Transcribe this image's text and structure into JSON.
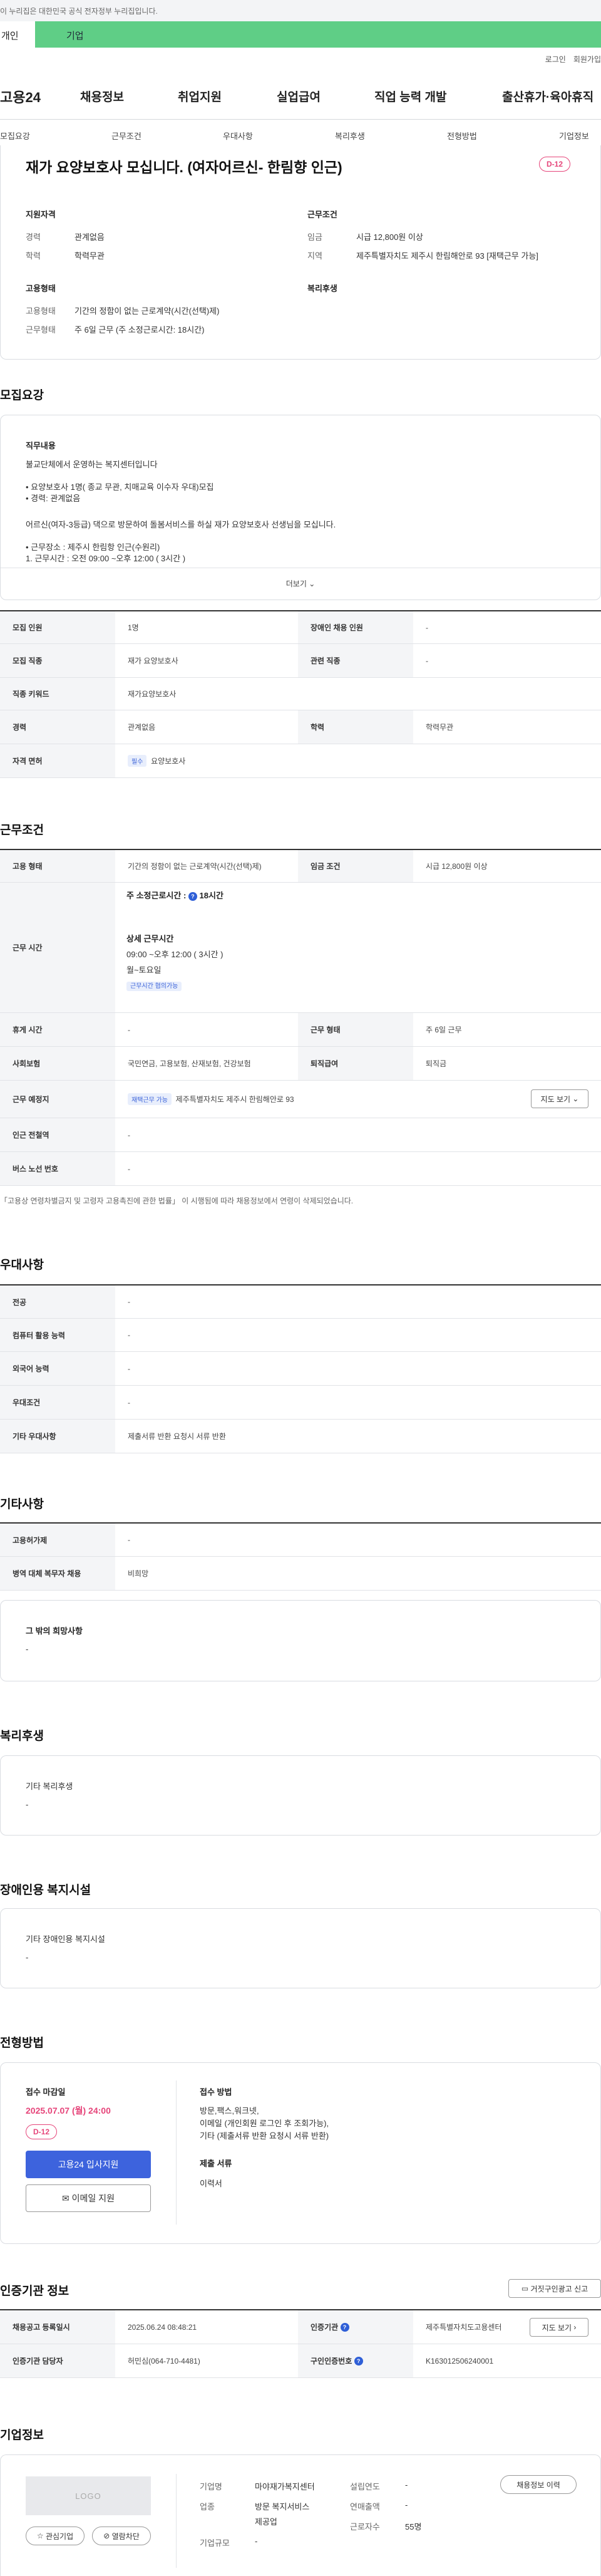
{
  "gov_banner": "이 누리집은 대한민국 공식 전자정부 누리집입니다.",
  "user_tabs": {
    "individual": "개인",
    "company": "기업"
  },
  "util": [
    "로그인",
    "회원가입"
  ],
  "logo": "고용24",
  "gnb": [
    "채용정보",
    "취업지원",
    "실업급여",
    "직업 능력 개발",
    "출산휴가·육아휴직"
  ],
  "subnav": [
    "모집요강",
    "근무조건",
    "우대사항",
    "복리후생",
    "전형방법",
    "기업정보"
  ],
  "job": {
    "title": "재가 요양보호사 모십니다. (여자어르신- 한림향 인근)",
    "dday": "D-12",
    "qual_h": "지원자격",
    "cond_h": "근무조건",
    "emp_h": "고용형태",
    "welfare_h": "복리후생",
    "qual": [
      {
        "k": "경력",
        "v": "관계없음"
      },
      {
        "k": "학력",
        "v": "학력무관"
      }
    ],
    "cond": [
      {
        "k": "임금",
        "v": "시급 12,800원 이상"
      },
      {
        "k": "지역",
        "v": "제주특별자치도 제주시 한림해안로 93 [재택근무 가능]"
      }
    ],
    "emp": [
      {
        "k": "고용형태",
        "v": "기간의 정함이 없는 근로계약(시간(선택)제)"
      },
      {
        "k": "근무형태",
        "v": "주 6일 근무 (주 소정근로시간: 18시간)"
      }
    ]
  },
  "recruit": {
    "heading": "모집요강",
    "duty_h": "직무내용",
    "duty_intro": "불교단체에서 운영하는 복지센터입니다",
    "duty_list1": [
      "요양보호사 1명( 종교 무관, 치매교육 이수자 우대)모집",
      "경력: 관계없음"
    ],
    "duty_para": "어르신(여자-3등급) 댁으로 방문하여 돌봄서비스를 하실 재가 요양보호사 선생님을 모십니다.",
    "duty_list2": [
      "근무장소 : 제주시 한림항 인근(수원리)",
      "근무시간 : 오전 09:00 ~오후 12:00 ( 3시간 )"
    ],
    "more": "더보기",
    "table": {
      "r1": {
        "h1": "모집 인원",
        "v1": "1명",
        "h2": "장애인 채용 인원",
        "v2": "-"
      },
      "r2": {
        "h1": "모집 직종",
        "v1": "재가 요양보호사",
        "h2": "관련 직종",
        "v2": "-"
      },
      "r3": {
        "h1": "직종 키워드",
        "v1": "재가요양보호사"
      },
      "r4": {
        "h1": "경력",
        "v1": "관계없음",
        "h2": "학력",
        "v2": "학력무관"
      },
      "r5": {
        "h1": "자격 면허",
        "chip": "필수",
        "v1": "요양보호사"
      }
    }
  },
  "work": {
    "heading": "근무조건",
    "r1": {
      "h1": "고용 형태",
      "v1": "기간의 정함이 없는 근로계약(시간(선택)제)",
      "h2": "임금 조건",
      "v2": "시급 12,800원 이상"
    },
    "hours": {
      "h": "근무 시간",
      "weekly_label": "주 소정근로시간 :",
      "weekly_val": "18시간",
      "detail_h": "상세 근무시간",
      "detail_time": "09:00 ~오후 12:00 ( 3시간 )",
      "days": "월~토요일",
      "chip": "근무시간 협의가능"
    },
    "r3": {
      "h1": "휴게 시간",
      "v1": "-",
      "h2": "근무 형태",
      "v2": "주 6일 근무"
    },
    "r4": {
      "h1": "사회보험",
      "v1": "국민연금, 고용보험, 산재보험, 건강보험",
      "h2": "퇴직급여",
      "v2": "퇴직금"
    },
    "r5": {
      "h1": "근무 예정지",
      "chip": "재택근무 가능",
      "v1": "제주특별자치도 제주시 한림해안로 93",
      "btn": "지도 보기"
    },
    "r6": {
      "h1": "인근 전철역",
      "v1": "-"
    },
    "r7": {
      "h1": "버스 노선 번호",
      "v1": "-"
    },
    "note": "「고용상 연령차별금지 및 고령자 고용촉진에 관한 법률」 이 시행됨에 따라 채용정보에서 연령이 삭제되었습니다."
  },
  "pref": {
    "heading": "우대사항",
    "rows": [
      {
        "h": "전공",
        "v": "-"
      },
      {
        "h": "컴퓨터 활용 능력",
        "v": "-"
      },
      {
        "h": "외국어 능력",
        "v": "-"
      },
      {
        "h": "우대조건",
        "v": "-"
      },
      {
        "h": "기타 우대사항",
        "v": "제출서류 반환 요청시 서류 반환"
      }
    ]
  },
  "etc": {
    "heading": "기타사항",
    "rows": [
      {
        "h": "고용허가제",
        "v": "-"
      },
      {
        "h": "병역 대체 복무자 채용",
        "v": "비희망"
      }
    ],
    "other_h": "그 밖의 희망사항",
    "other_v": "-"
  },
  "welfare": {
    "heading": "복리후생",
    "sub": "기타 복리후생",
    "val": "-"
  },
  "facility": {
    "heading": "장애인용 복지시설",
    "sub": "기타 장애인용 복지시설",
    "val": "-"
  },
  "process": {
    "heading": "전형방법",
    "deadline_h": "접수 마감일",
    "deadline": "2025.07.07 (월) 24:00",
    "dday": "D-12",
    "apply_btn": "고용24 입사지원",
    "email_btn": "이메일 지원",
    "method_h": "접수 방법",
    "method_lines": [
      "방문,팩스,워크넷,",
      "이메일 (개인회원 로그인 후 조회가능),",
      "기타 (제출서류 반환 요청시 서류 반환)"
    ],
    "docs_h": "제출 서류",
    "docs": "이력서"
  },
  "agency": {
    "heading": "인증기관 정보",
    "report_btn": "거짓구인광고 신고",
    "r1": {
      "h1": "채용공고 등록일시",
      "v1": "2025.06.24 08:48:21",
      "h2": "인증기관",
      "v2": "제주특별자치도고용센터",
      "btn": "지도 보기"
    },
    "r2": {
      "h1": "인증기관 담당자",
      "v1": "허민심(064-710-4481)",
      "h2": "구인인증번호",
      "v2": "K163012506240001"
    }
  },
  "company": {
    "heading": "기업정보",
    "logo": "LOGO",
    "fav_btn": "관심기업",
    "block_btn": "열람차단",
    "hist_btn": "채용정보 이력",
    "name_h": "기업명",
    "name": "마야재가복지센터",
    "biz_h": "업종",
    "biz": [
      "방문 복지서비스",
      "제공업"
    ],
    "size_h": "기업규모",
    "size": "-",
    "est_h": "설립연도",
    "est": "-",
    "sales_h": "연매출액",
    "sales": "-",
    "emp_h": "근로자수",
    "emp": "55명"
  }
}
